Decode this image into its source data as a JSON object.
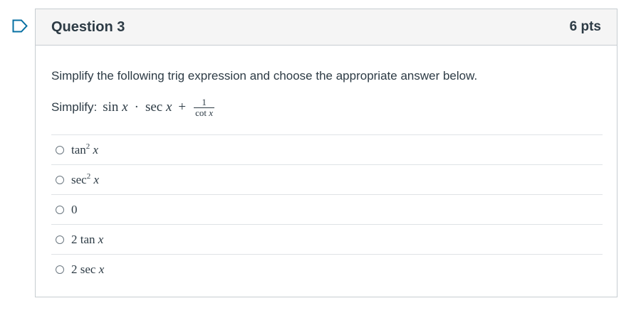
{
  "question": {
    "title": "Question 3",
    "points": "6 pts",
    "prompt": "Simplify the following trig expression and choose the appropriate answer below.",
    "simplify_label": "Simplify:",
    "expression": {
      "term1_fn": "sin",
      "term1_var": "x",
      "dot": "·",
      "term2_fn": "sec",
      "term2_var": "x",
      "plus": "+",
      "frac_num": "1",
      "frac_den_fn": "cot",
      "frac_den_var": "x"
    }
  },
  "answers": [
    {
      "coef": "",
      "fn": "tan",
      "power": "2",
      "var": "x"
    },
    {
      "coef": "",
      "fn": "sec",
      "power": "2",
      "var": "x"
    },
    {
      "coef": "0",
      "fn": "",
      "power": "",
      "var": ""
    },
    {
      "coef": "2",
      "fn": "tan",
      "power": "",
      "var": "x"
    },
    {
      "coef": "2",
      "fn": "sec",
      "power": "",
      "var": "x"
    }
  ],
  "colors": {
    "text": "#2d3b45",
    "header_bg": "#f5f5f5",
    "border": "#c7cdd1",
    "flag": "#0770a3"
  },
  "icons": {
    "flag": "bookmark-flag-icon",
    "radio": "radio-button-icon"
  }
}
